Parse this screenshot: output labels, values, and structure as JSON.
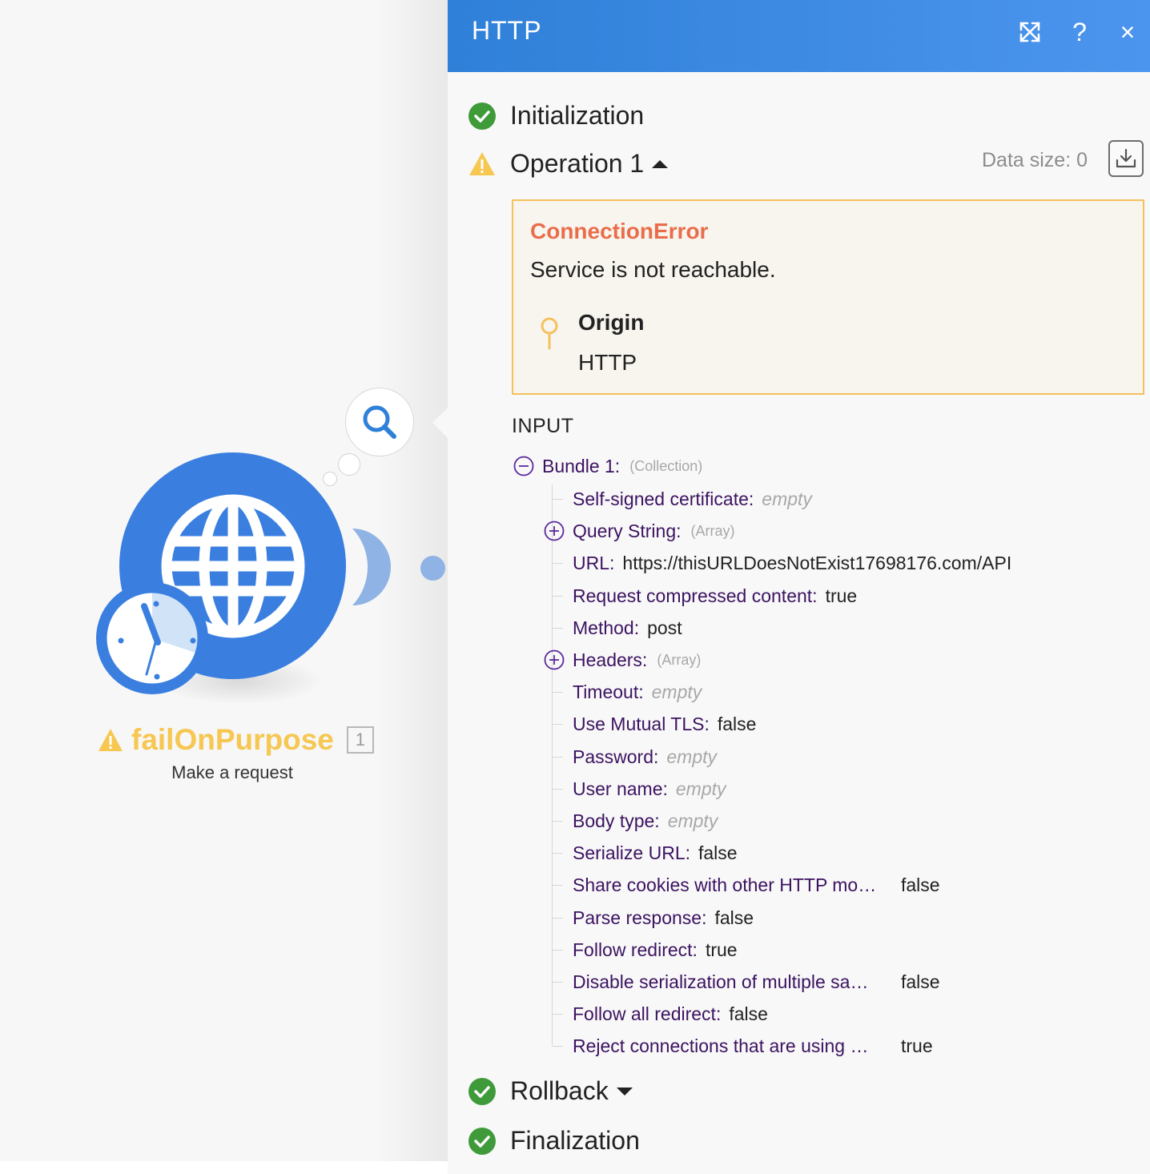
{
  "module": {
    "name": "failOnPurpose",
    "subtitle": "Make a request",
    "count": "1"
  },
  "panel": {
    "title": "HTTP",
    "buttons": {
      "expand": "expand-icon",
      "help": "?",
      "close": "×"
    },
    "sections": {
      "initialization": "Initialization",
      "operation": "Operation 1",
      "rollback": "Rollback",
      "finalization": "Finalization"
    },
    "data_size": "Data size: 0",
    "error": {
      "title": "ConnectionError",
      "message": "Service is not reachable.",
      "origin_label": "Origin",
      "origin_value": "HTTP"
    },
    "input_title": "INPUT",
    "bundle": {
      "key": "Bundle 1:",
      "type": "(Collection)"
    },
    "fields": [
      {
        "key": "Self-signed certificate:",
        "value": "empty",
        "kind": "empty"
      },
      {
        "key": "Query String:",
        "value": "(Array)",
        "kind": "type",
        "expandable": true
      },
      {
        "key": "URL:",
        "value": "https://thisURLDoesNotExist17698176.com/API",
        "kind": "value"
      },
      {
        "key": "Request compressed content:",
        "value": "true",
        "kind": "value"
      },
      {
        "key": "Method:",
        "value": "post",
        "kind": "value"
      },
      {
        "key": "Headers:",
        "value": "(Array)",
        "kind": "type",
        "expandable": true
      },
      {
        "key": "Timeout:",
        "value": "empty",
        "kind": "empty"
      },
      {
        "key": "Use Mutual TLS:",
        "value": "false",
        "kind": "value"
      },
      {
        "key": "Password:",
        "value": "empty",
        "kind": "empty"
      },
      {
        "key": "User name:",
        "value": "empty",
        "kind": "empty"
      },
      {
        "key": "Body type:",
        "value": "empty",
        "kind": "empty"
      },
      {
        "key": "Serialize URL:",
        "value": "false",
        "kind": "value"
      },
      {
        "key": "Share cookies with other HTTP mo…",
        "value": "false",
        "kind": "value"
      },
      {
        "key": "Parse response:",
        "value": "false",
        "kind": "value"
      },
      {
        "key": "Follow redirect:",
        "value": "true",
        "kind": "value"
      },
      {
        "key": "Disable serialization of multiple sa…",
        "value": "false",
        "kind": "value"
      },
      {
        "key": "Follow all redirect:",
        "value": "false",
        "kind": "value"
      },
      {
        "key": "Reject connections that are using …",
        "value": "true",
        "kind": "value"
      }
    ]
  },
  "colors": {
    "header": "#3a87e6",
    "module": "#3a7fe0",
    "success": "#3f9a3a",
    "warning": "#f6c751",
    "error_title": "#ea6d4a",
    "key": "#3c1361"
  }
}
